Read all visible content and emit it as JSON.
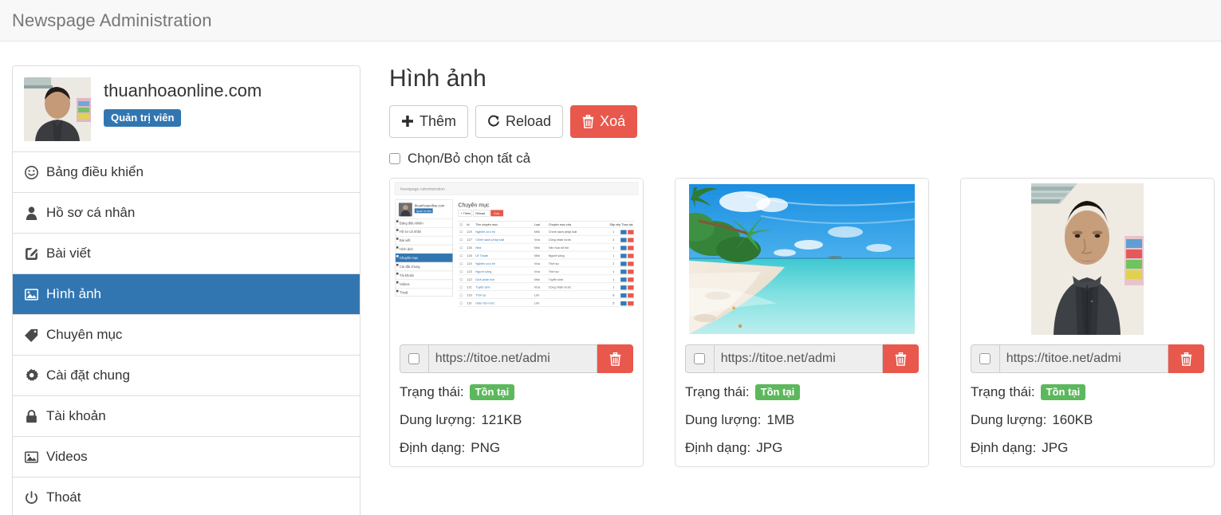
{
  "header": {
    "title": "Newspage Administration"
  },
  "sidebar": {
    "profile": {
      "name": "thuanhoaonline.com",
      "role_badge": "Quản trị viên",
      "avatar_icon": "user-photo-avatar"
    },
    "items": [
      {
        "label": "Bảng điều khiển",
        "icon": "dashboard-icon",
        "active": false
      },
      {
        "label": "Hồ sơ cá nhân",
        "icon": "user-icon",
        "active": false
      },
      {
        "label": "Bài viết",
        "icon": "edit-square-icon",
        "active": false
      },
      {
        "label": "Hình ảnh",
        "icon": "picture-icon",
        "active": true
      },
      {
        "label": "Chuyên mục",
        "icon": "tag-icon",
        "active": false
      },
      {
        "label": "Cài đặt chung",
        "icon": "gear-icon",
        "active": false
      },
      {
        "label": "Tài khoản",
        "icon": "lock-icon",
        "active": false
      },
      {
        "label": "Videos",
        "icon": "picture-icon",
        "active": false
      },
      {
        "label": "Thoát",
        "icon": "power-off-icon",
        "active": false
      }
    ]
  },
  "main": {
    "page_title": "Hình ảnh",
    "toolbar": [
      {
        "label": "Thêm",
        "icon": "plus-icon",
        "style": "default"
      },
      {
        "label": "Reload",
        "icon": "refresh-icon",
        "style": "default"
      },
      {
        "label": "Xoá",
        "icon": "trash-icon",
        "style": "danger"
      }
    ],
    "select_all_label": "Chọn/Bỏ chọn tất cả",
    "select_all_checked": false,
    "labels": {
      "status": "Trạng thái:",
      "size": "Dung lượng:",
      "format": "Định dạng:"
    },
    "cards": [
      {
        "url_value": "https://titoe.net/admi",
        "checked": false,
        "status_badge": "Tồn tại",
        "size": "121KB",
        "format": "PNG",
        "thumb_kind": "screenshot",
        "thumb_alt": "admin-categories-screenshot"
      },
      {
        "url_value": "https://titoe.net/admi",
        "checked": false,
        "status_badge": "Tồn tại",
        "size": "1MB",
        "format": "JPG",
        "thumb_kind": "beach",
        "thumb_alt": "tropical-beach-photo"
      },
      {
        "url_value": "https://titoe.net/admi",
        "checked": false,
        "status_badge": "Tồn tại",
        "size": "160KB",
        "format": "JPG",
        "thumb_kind": "portrait",
        "thumb_alt": "man-portrait-photo"
      }
    ]
  },
  "colors": {
    "primary": "#3276b1",
    "danger": "#e8584c",
    "success": "#5cb85c",
    "header_bg": "#f8f8f8",
    "border": "#dddddd"
  },
  "inner_screenshot": {
    "title": "Newspage Administration",
    "page_title": "Chuyên mục",
    "buttons": [
      "Thêm",
      "Reload",
      "Xoá"
    ],
    "columns": [
      "",
      "Id",
      "Tên chuyên mục",
      "Loại",
      "Chuyên mục cha",
      "Sắp xếp",
      "Thao tác"
    ],
    "rows": [
      [
        "129",
        "Nghiên cứu tin",
        "Nhỏ",
        "Chính sách pháp luật",
        "1"
      ],
      [
        "127",
        "Chính sách pháp luật",
        "Vừa",
        "Công nhân nước",
        "2"
      ],
      [
        "126",
        "Nhà",
        "Nhỏ",
        "Văn hoá xã hội",
        "1"
      ],
      [
        "125",
        "Lễ Thuận",
        "Nhỏ",
        "Người sống",
        "1"
      ],
      [
        "124",
        "Nghiên cứu tin",
        "Vừa",
        "Thời sự",
        "2"
      ],
      [
        "123",
        "Người sống",
        "Vừa",
        "Thời sự",
        "1"
      ],
      [
        "122",
        "Dịch phân tích",
        "Nhỏ",
        "Tuyển sinh",
        "1"
      ],
      [
        "121",
        "Tuyển sinh",
        "Vừa",
        "Công nhân nước",
        "1"
      ],
      [
        "120",
        "Thời sự",
        "Lớn",
        "",
        "8"
      ],
      [
        "119",
        "Giáo hội nước",
        "Lớn",
        "",
        "5"
      ]
    ]
  }
}
